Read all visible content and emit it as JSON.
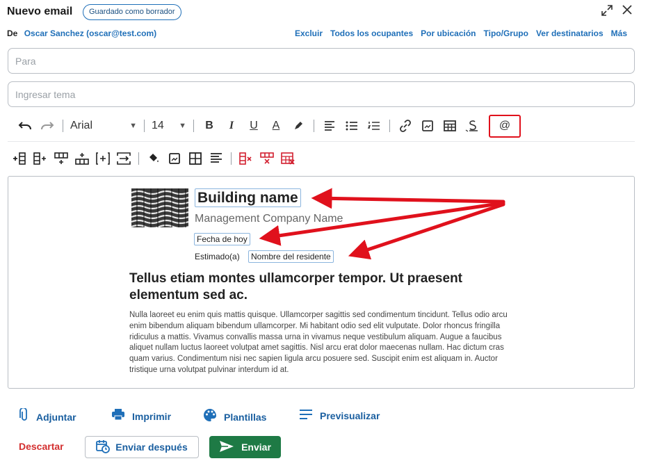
{
  "header": {
    "title": "Nuevo email",
    "badge": "Guardado como borrador"
  },
  "from": {
    "label": "De",
    "value": "Oscar Sanchez (oscar@test.com)"
  },
  "recipient_links": [
    "Excluir",
    "Todos los ocupantes",
    "Por ubicación",
    "Tipo/Grupo",
    "Ver destinatarios",
    "Más"
  ],
  "to_field": {
    "placeholder": "Para"
  },
  "subject_field": {
    "placeholder": "Ingresar tema"
  },
  "toolbar": {
    "font": "Arial",
    "size": "14",
    "mention_symbol": "@"
  },
  "editor": {
    "building_name": "Building name",
    "management_company": "Management Company Name",
    "date_tag": "Fecha de hoy",
    "greeting_label": "Estimado(a)",
    "resident_tag": "Nombre del residente",
    "heading": "Tellus etiam montes ullamcorper tempor. Ut praesent elementum sed ac.",
    "paragraph": "Nulla laoreet eu enim quis mattis quisque. Ullamcorper sagittis sed condimentum tincidunt. Tellus odio arcu enim bibendum aliquam bibendum ullamcorper. Mi habitant odio sed elit vulputate. Dolor rhoncus fringilla ridiculus a mattis. Vivamus convallis massa urna in vivamus neque vestibulum aliquam. Augue a faucibus aliquet nullam luctus laoreet volutpat amet sagittis. Nisl arcu erat dolor maecenas nullam. Hac dictum cras quam varius. Condimentum nisi nec sapien ligula arcu posuere sed. Suscipit enim est aliquam in. Auctor tristique urna volutpat pulvinar interdum id at."
  },
  "actions": {
    "attach": "Adjuntar",
    "print": "Imprimir",
    "templates": "Plantillas",
    "preview": "Previsualizar"
  },
  "footer": {
    "discard": "Descartar",
    "send_later": "Enviar después",
    "send": "Enviar"
  },
  "colors": {
    "link": "#1f6fb8",
    "send_button": "#1e7a45",
    "discard": "#d32f2f",
    "annotation": "#e0111c"
  }
}
